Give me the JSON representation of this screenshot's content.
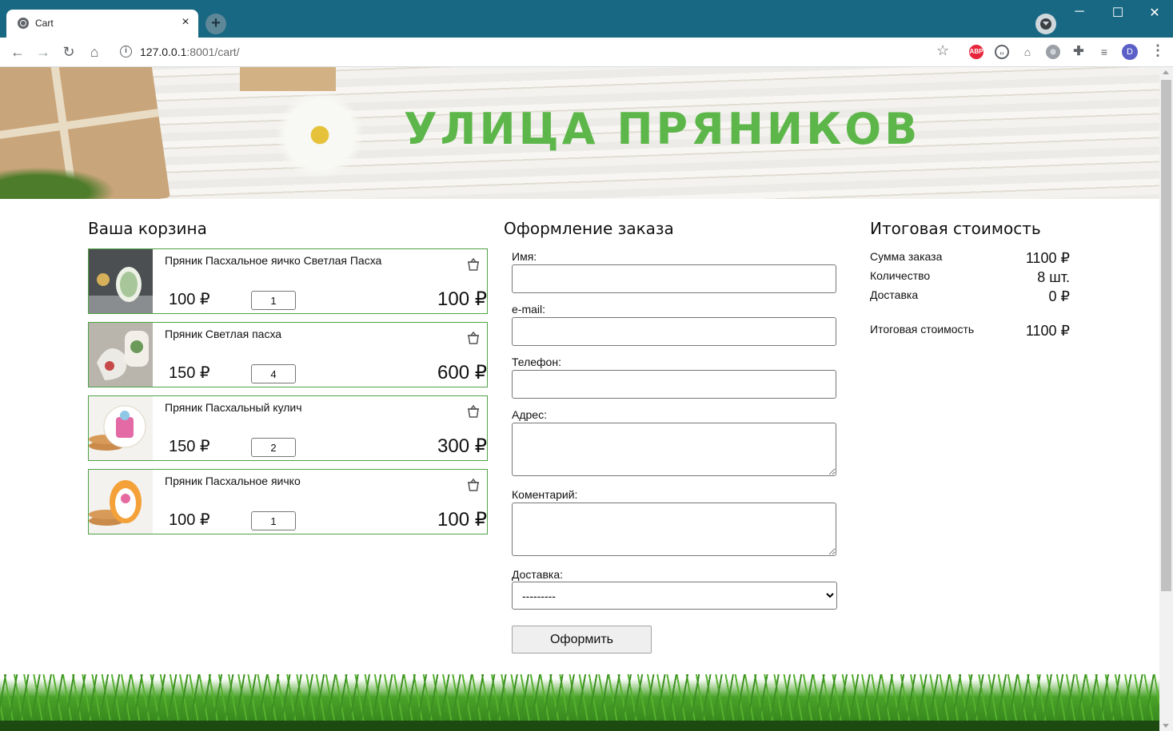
{
  "browser": {
    "tab_title": "Cart",
    "tab_close": "×",
    "new_tab": "+",
    "url_host": "127.0.0.1",
    "url_rest": ":8001/cart/",
    "avatar_letter": "D",
    "ext_abp": "ABP",
    "win_minimize": "─",
    "win_maximize": "☐",
    "win_close": "✕",
    "icons": [
      "globe-icon",
      "back-icon",
      "forward-icon",
      "reload-icon",
      "home-icon",
      "info-icon",
      "star-icon",
      "extensions-icon",
      "menu-icon"
    ]
  },
  "banner": {
    "brand": "УЛИЦА ПРЯНИКОВ"
  },
  "cart": {
    "heading": "Ваша корзина",
    "items": [
      {
        "name": "Пряник Пасхальное яичко Светлая Пасха",
        "price": "100 ₽",
        "qty": "1",
        "total": "100 ₽"
      },
      {
        "name": "Пряник Светлая пасха",
        "price": "150 ₽",
        "qty": "4",
        "total": "600 ₽"
      },
      {
        "name": "Пряник Пасхальный кулич",
        "price": "150 ₽",
        "qty": "2",
        "total": "300 ₽"
      },
      {
        "name": "Пряник Пасхальное яичко",
        "price": "100 ₽",
        "qty": "1",
        "total": "100 ₽"
      }
    ]
  },
  "order": {
    "heading": "Оформление заказа",
    "name_label": "Имя:",
    "email_label": "e-mail:",
    "phone_label": "Телефон:",
    "address_label": "Адрес:",
    "comment_label": "Коментарий:",
    "delivery_label": "Доставка:",
    "delivery_selected": "---------",
    "submit_label": "Оформить"
  },
  "summary": {
    "heading": "Итоговая стоимость",
    "sum_label": "Сумма заказа",
    "sum_value": "1100 ₽",
    "qty_label": "Количество",
    "qty_value": "8 шт.",
    "delivery_label": "Доставка",
    "delivery_value": "0 ₽",
    "total_label": "Итоговая стоимость",
    "total_value": "1100 ₽"
  },
  "colors": {
    "chrome": "#186883",
    "accent_green": "#4fa245",
    "brand_green": "#5db649"
  }
}
